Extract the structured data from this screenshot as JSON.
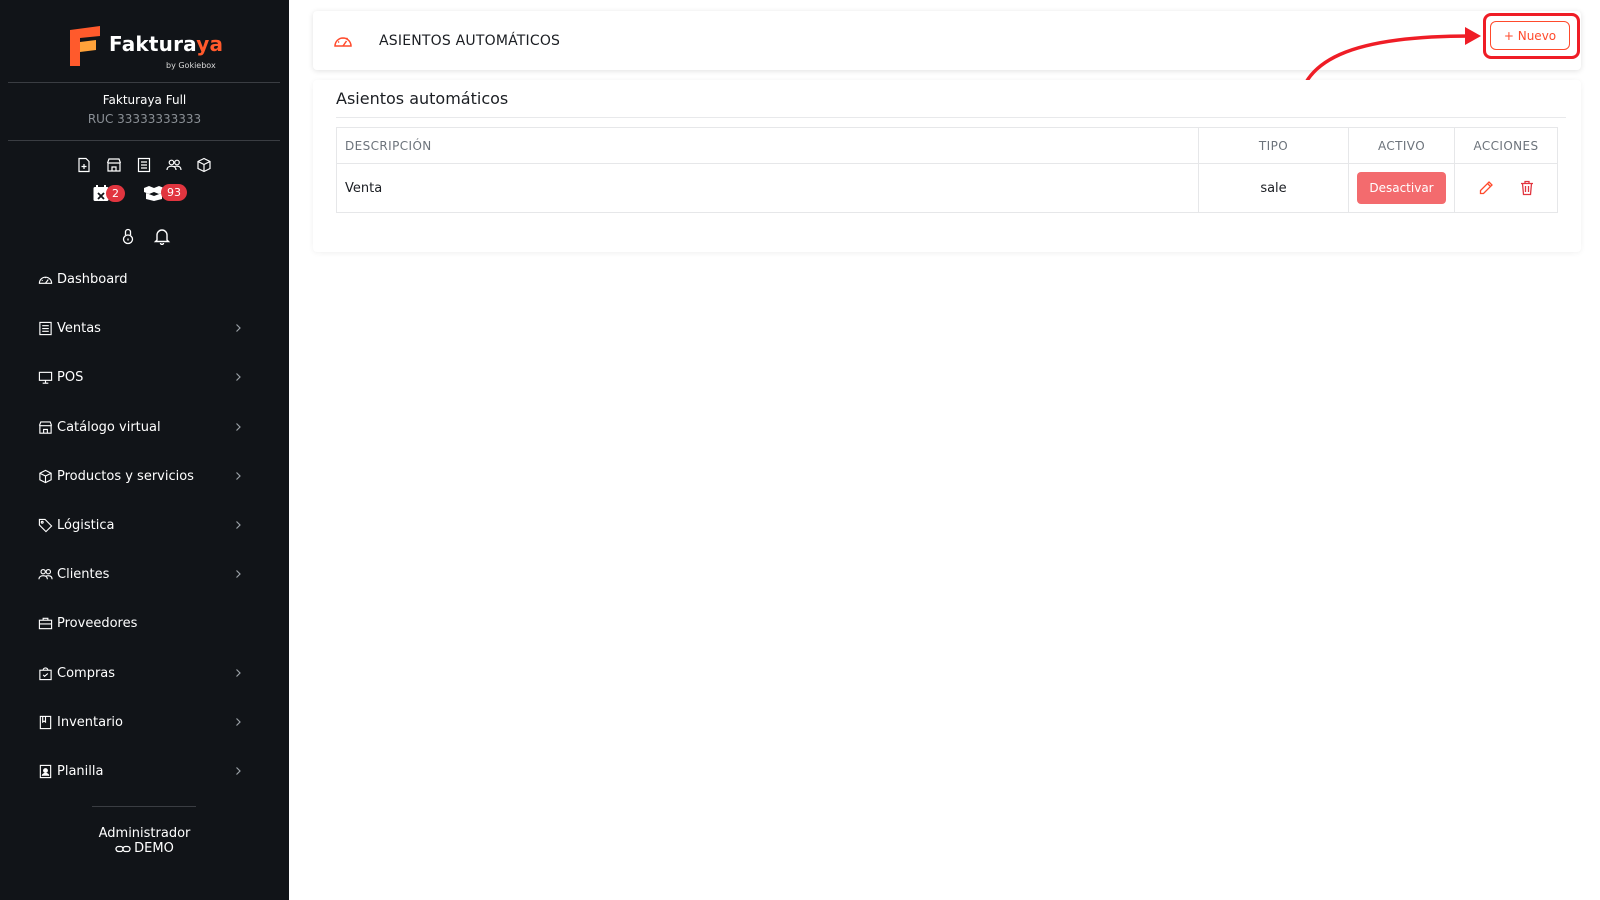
{
  "brand": {
    "name_main": "Faktura",
    "name_accent": "ya",
    "byline": "by Gokiebox"
  },
  "company": {
    "name": "Fakturaya Full",
    "ruc": "RUC 33333333333"
  },
  "badges": {
    "calendar_count": "2",
    "boxes_count": "93"
  },
  "menu": [
    {
      "label": "Dashboard",
      "icon": "speedometer-icon",
      "has_chevron": false
    },
    {
      "label": "Ventas",
      "icon": "receipt-icon",
      "has_chevron": true
    },
    {
      "label": "POS",
      "icon": "monitor-icon",
      "has_chevron": true
    },
    {
      "label": "Catálogo virtual",
      "icon": "store-icon",
      "has_chevron": true
    },
    {
      "label": "Productos y servicios",
      "icon": "box-icon",
      "has_chevron": true
    },
    {
      "label": "Lógistica",
      "icon": "tag-icon",
      "has_chevron": true
    },
    {
      "label": "Clientes",
      "icon": "users-icon",
      "has_chevron": true
    },
    {
      "label": "Proveedores",
      "icon": "briefcase-icon",
      "has_chevron": false
    },
    {
      "label": "Compras",
      "icon": "shopping-bag-icon",
      "has_chevron": true
    },
    {
      "label": "Inventario",
      "icon": "book-icon",
      "has_chevron": true
    },
    {
      "label": "Planilla",
      "icon": "id-card-icon",
      "has_chevron": true
    }
  ],
  "user": {
    "role": "Administrador",
    "name": "DEMO"
  },
  "header": {
    "title": "ASIENTOS AUTOMÁTICOS",
    "new_button": "+ Nuevo"
  },
  "section": {
    "title": "Asientos automáticos"
  },
  "table": {
    "columns": {
      "descripcion": "DESCRIPCIÓN",
      "tipo": "TIPO",
      "activo": "ACTIVO",
      "acciones": "ACCIONES"
    },
    "rows": [
      {
        "descripcion": "Venta",
        "tipo": "sale",
        "activo_button": "Desactivar"
      }
    ]
  },
  "colors": {
    "sidebar_bg": "#111418",
    "accent": "#ff4a2c",
    "danger": "#f36b6e",
    "highlight": "#ef1d26"
  }
}
